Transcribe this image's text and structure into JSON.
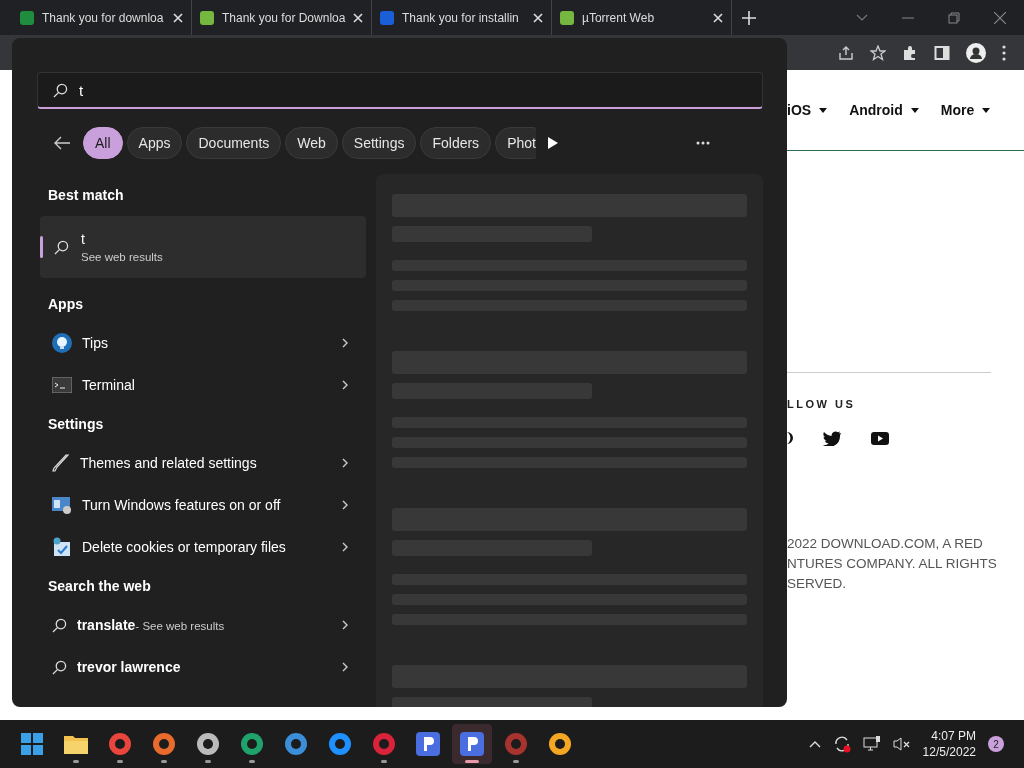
{
  "browser": {
    "tabs": [
      {
        "title": "Thank you for downloa"
      },
      {
        "title": "Thank you for Downloa"
      },
      {
        "title": "Thank you for installin"
      },
      {
        "title": "µTorrent Web"
      }
    ]
  },
  "page": {
    "nav": [
      "iOS",
      "Android",
      "More"
    ],
    "follow_heading": "LLOW US",
    "copyright": "2022 DOWNLOAD.COM, A RED NTURES COMPANY. ALL RIGHTS SERVED."
  },
  "search": {
    "value": "t",
    "filters": [
      {
        "label": "All",
        "selected": true
      },
      {
        "label": "Apps",
        "selected": false
      },
      {
        "label": "Documents",
        "selected": false
      },
      {
        "label": "Web",
        "selected": false
      },
      {
        "label": "Settings",
        "selected": false
      },
      {
        "label": "Folders",
        "selected": false
      },
      {
        "label": "Phot",
        "selected": false
      }
    ],
    "sections": [
      {
        "heading": "Best match",
        "items": [
          {
            "kind": "best",
            "title": "t",
            "subtitle": "See web results",
            "selected": true
          }
        ]
      },
      {
        "heading": "Apps",
        "items": [
          {
            "kind": "tips",
            "title": "Tips"
          },
          {
            "kind": "terminal",
            "title": "Terminal"
          }
        ]
      },
      {
        "heading": "Settings",
        "items": [
          {
            "kind": "brush",
            "title": "Themes and related settings"
          },
          {
            "kind": "features",
            "title": "Turn Windows features on or off"
          },
          {
            "kind": "cleanup",
            "title": "Delete cookies or temporary files"
          }
        ]
      },
      {
        "heading": "Search the web",
        "items": [
          {
            "kind": "web",
            "title": "translate",
            "subtitle": "- See web results"
          },
          {
            "kind": "web",
            "title": "trevor lawrence"
          }
        ]
      }
    ]
  },
  "taskbar": {
    "apps": [
      {
        "kind": "start",
        "running": false,
        "selected": false
      },
      {
        "kind": "folder",
        "running": true,
        "selected": false
      },
      {
        "kind": "app",
        "running": true,
        "selected": false
      },
      {
        "kind": "app",
        "running": true,
        "selected": false
      },
      {
        "kind": "app",
        "running": true,
        "selected": false
      },
      {
        "kind": "app",
        "running": true,
        "selected": false
      },
      {
        "kind": "app",
        "running": false,
        "selected": false
      },
      {
        "kind": "app",
        "running": false,
        "selected": false
      },
      {
        "kind": "app",
        "running": true,
        "selected": false
      },
      {
        "kind": "letter",
        "running": false,
        "selected": false
      },
      {
        "kind": "letter",
        "running": true,
        "selected": true
      },
      {
        "kind": "app",
        "running": true,
        "selected": false
      },
      {
        "kind": "app",
        "running": false,
        "selected": false
      }
    ],
    "time": "4:07 PM",
    "date": "12/5/2022",
    "notifications": "2"
  }
}
